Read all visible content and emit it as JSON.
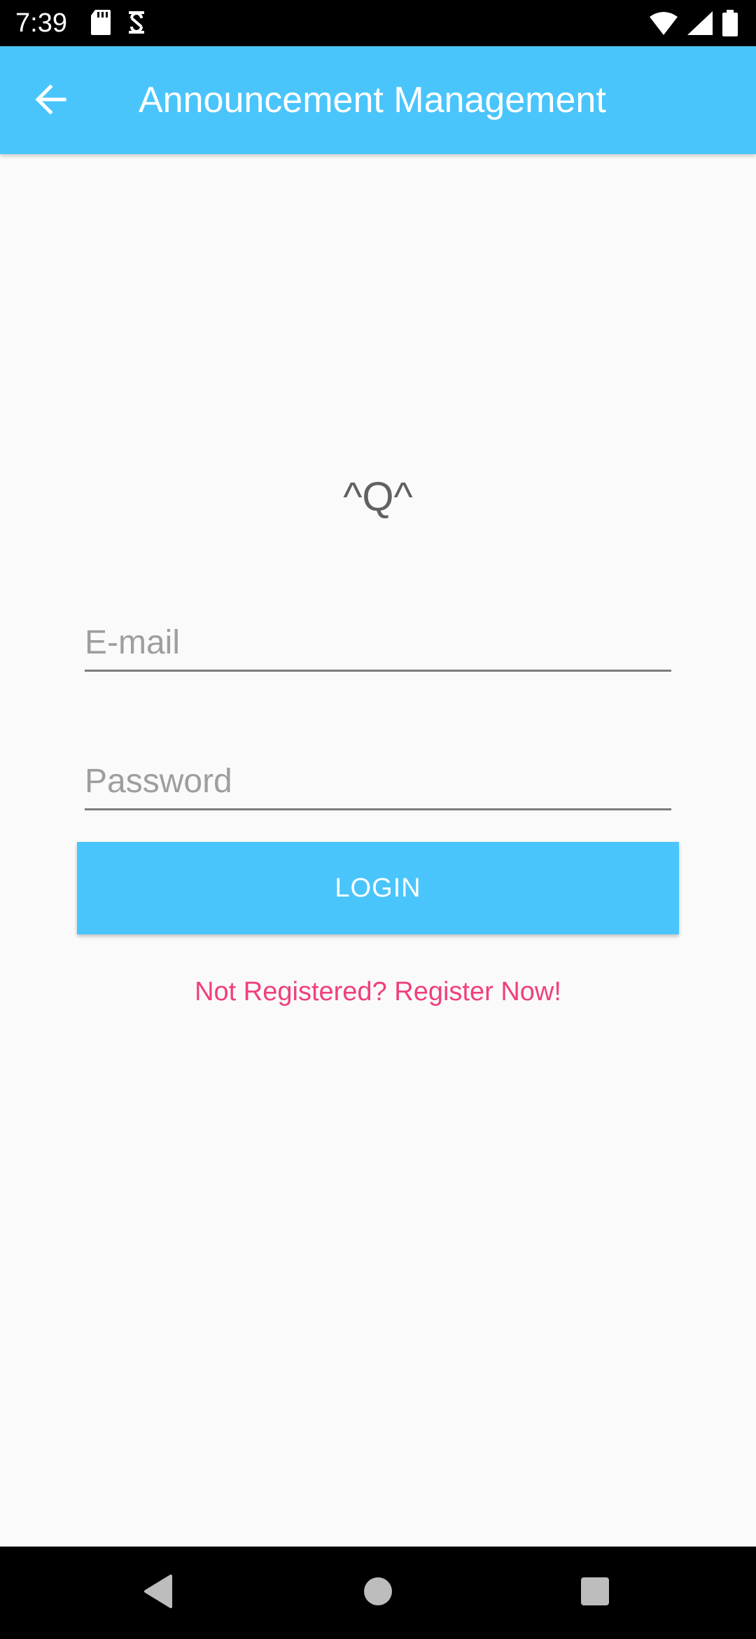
{
  "status_bar": {
    "time": "7:39",
    "left_icons": [
      "sd-card-icon",
      "sync-icon"
    ],
    "right_icons": [
      "wifi-icon",
      "signal-icon",
      "battery-icon"
    ]
  },
  "app_bar": {
    "title": "Announcement Management",
    "back_icon": "arrow-back-icon",
    "background_color": "#4ac5fb"
  },
  "login": {
    "logo_text": "^Q^",
    "email_placeholder": "E-mail",
    "email_value": "",
    "password_placeholder": "Password",
    "password_value": "",
    "login_label": "LOGIN",
    "register_link": "Not Registered? Register Now!",
    "accent_color": "#f0407a"
  },
  "nav_bar": {
    "buttons": [
      "back-triangle-icon",
      "home-circle-icon",
      "recents-square-icon"
    ]
  }
}
